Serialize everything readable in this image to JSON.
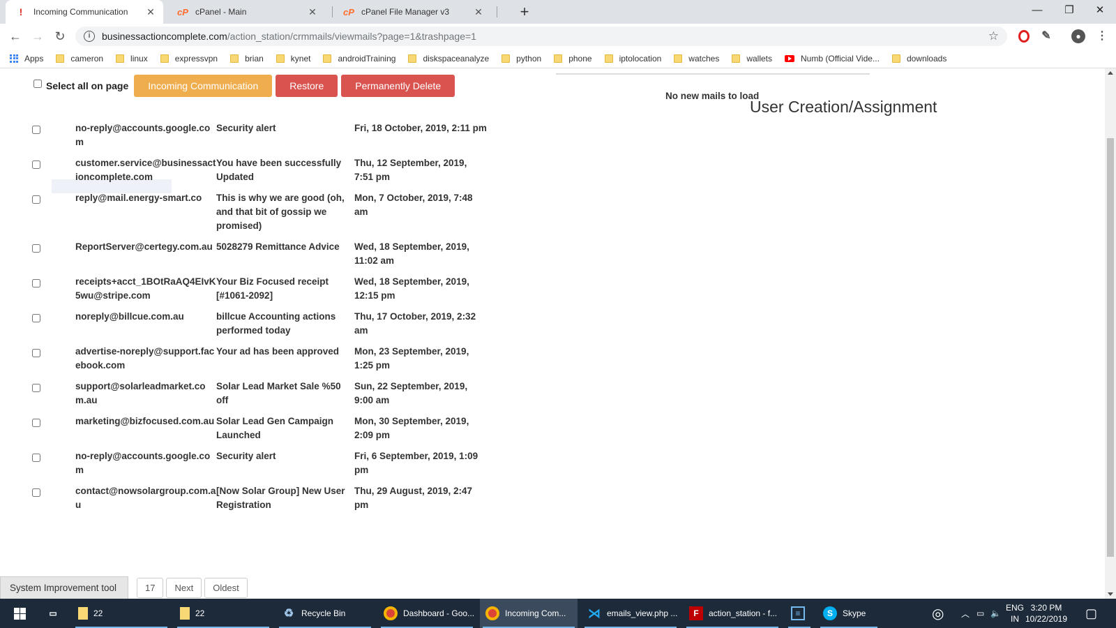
{
  "browser": {
    "tabs": [
      {
        "title": "Incoming Communication",
        "icon": "warning-icon",
        "active": true
      },
      {
        "title": "cPanel - Main",
        "icon": "cpanel-icon",
        "active": false
      },
      {
        "title": "cPanel File Manager v3",
        "icon": "cpanel-icon",
        "active": false
      }
    ],
    "new_tab_glyph": "+",
    "url_host": "businessactioncomplete.com",
    "url_path": "/action_station/crmmails/viewmails?page=1&trashpage=1",
    "window_controls": {
      "minimize": "—",
      "restore": "❐",
      "close": "✕"
    }
  },
  "bookmarks": [
    {
      "label": "Apps",
      "icon": "apps-grid-icon"
    },
    {
      "label": "cameron",
      "icon": "folder-icon"
    },
    {
      "label": "linux",
      "icon": "folder-icon"
    },
    {
      "label": "expressvpn",
      "icon": "folder-icon"
    },
    {
      "label": "brian",
      "icon": "folder-icon"
    },
    {
      "label": "kynet",
      "icon": "folder-icon"
    },
    {
      "label": "androidTraining",
      "icon": "folder-icon"
    },
    {
      "label": "diskspaceanalyze",
      "icon": "folder-icon"
    },
    {
      "label": "python",
      "icon": "folder-icon"
    },
    {
      "label": "phone",
      "icon": "folder-icon"
    },
    {
      "label": "iptolocation",
      "icon": "folder-icon"
    },
    {
      "label": "watches",
      "icon": "folder-icon"
    },
    {
      "label": "wallets",
      "icon": "folder-icon"
    },
    {
      "label": "Numb (Official Vide...",
      "icon": "youtube-icon"
    },
    {
      "label": "downloads",
      "icon": "folder-icon"
    }
  ],
  "actions": {
    "select_all_label": "Select all on page",
    "incoming_label": "Incoming Communication",
    "restore_label": "Restore",
    "delete_label": "Permanently Delete"
  },
  "mails": [
    {
      "from": "no-reply@accounts.google.com",
      "subject": "Security alert",
      "date": "Fri, 18 October, 2019, 2:11 pm"
    },
    {
      "from": "customer.service@businessactioncomplete.com",
      "subject": "You have been successfully Updated",
      "date": "Thu, 12 September, 2019, 7:51 pm"
    },
    {
      "from": "reply@mail.energy-smart.co",
      "subject": "This is why we are good (oh, and that bit of gossip we promised)",
      "date": "Mon, 7 October, 2019, 7:48 am"
    },
    {
      "from": "ReportServer@certegy.com.au",
      "subject": "5028279 Remittance Advice",
      "date": "Wed, 18 September, 2019, 11:02 am"
    },
    {
      "from": "receipts+acct_1BOtRaAQ4EIvK5wu@stripe.com",
      "subject": "Your Biz Focused receipt [#1061-2092]",
      "date": "Wed, 18 September, 2019, 12:15 pm"
    },
    {
      "from": "noreply@billcue.com.au",
      "subject": "billcue Accounting actions performed today",
      "date": "Thu, 17 October, 2019, 2:32 am"
    },
    {
      "from": "advertise-noreply@support.facebook.com",
      "subject": "Your ad has been approved",
      "date": "Mon, 23 September, 2019, 1:25 pm"
    },
    {
      "from": "support@solarleadmarket.com.au",
      "subject": "Solar Lead Market Sale %50 off",
      "date": "Sun, 22 September, 2019, 9:00 am"
    },
    {
      "from": "marketing@bizfocused.com.au",
      "subject": "Solar Lead Gen Campaign Launched",
      "date": "Mon, 30 September, 2019, 2:09 pm"
    },
    {
      "from": "no-reply@accounts.google.com",
      "subject": "Security alert",
      "date": "Fri, 6 September, 2019, 1:09 pm"
    },
    {
      "from": "contact@nowsolargroup.com.au",
      "subject": "[Now Solar Group] New User Registration",
      "date": "Thu, 29 August, 2019, 2:47 pm"
    }
  ],
  "right_panel": {
    "no_mail_text": "No new mails to load",
    "title": "User Creation/Assignment"
  },
  "pager": [
    "17",
    "Next",
    "Oldest"
  ],
  "system_tool_label": "System Improvement tool",
  "taskbar": {
    "items": [
      {
        "label": "22",
        "icon": "file-explorer-icon"
      },
      {
        "label": "22",
        "icon": "file-explorer-icon"
      },
      {
        "label": "Recycle Bin",
        "icon": "recycle-bin-icon"
      },
      {
        "label": "Dashboard - Goo...",
        "icon": "chrome-icon"
      },
      {
        "label": "Incoming Com...",
        "icon": "chrome-icon"
      },
      {
        "label": "emails_view.php ...",
        "icon": "vscode-icon"
      },
      {
        "label": "action_station - f...",
        "icon": "filezilla-icon"
      },
      {
        "label": "",
        "icon": "app-icon"
      },
      {
        "label": "Skype",
        "icon": "skype-icon"
      }
    ],
    "lang": "ENG",
    "region": "IN",
    "time": "3:20 PM",
    "date": "10/22/2019"
  }
}
